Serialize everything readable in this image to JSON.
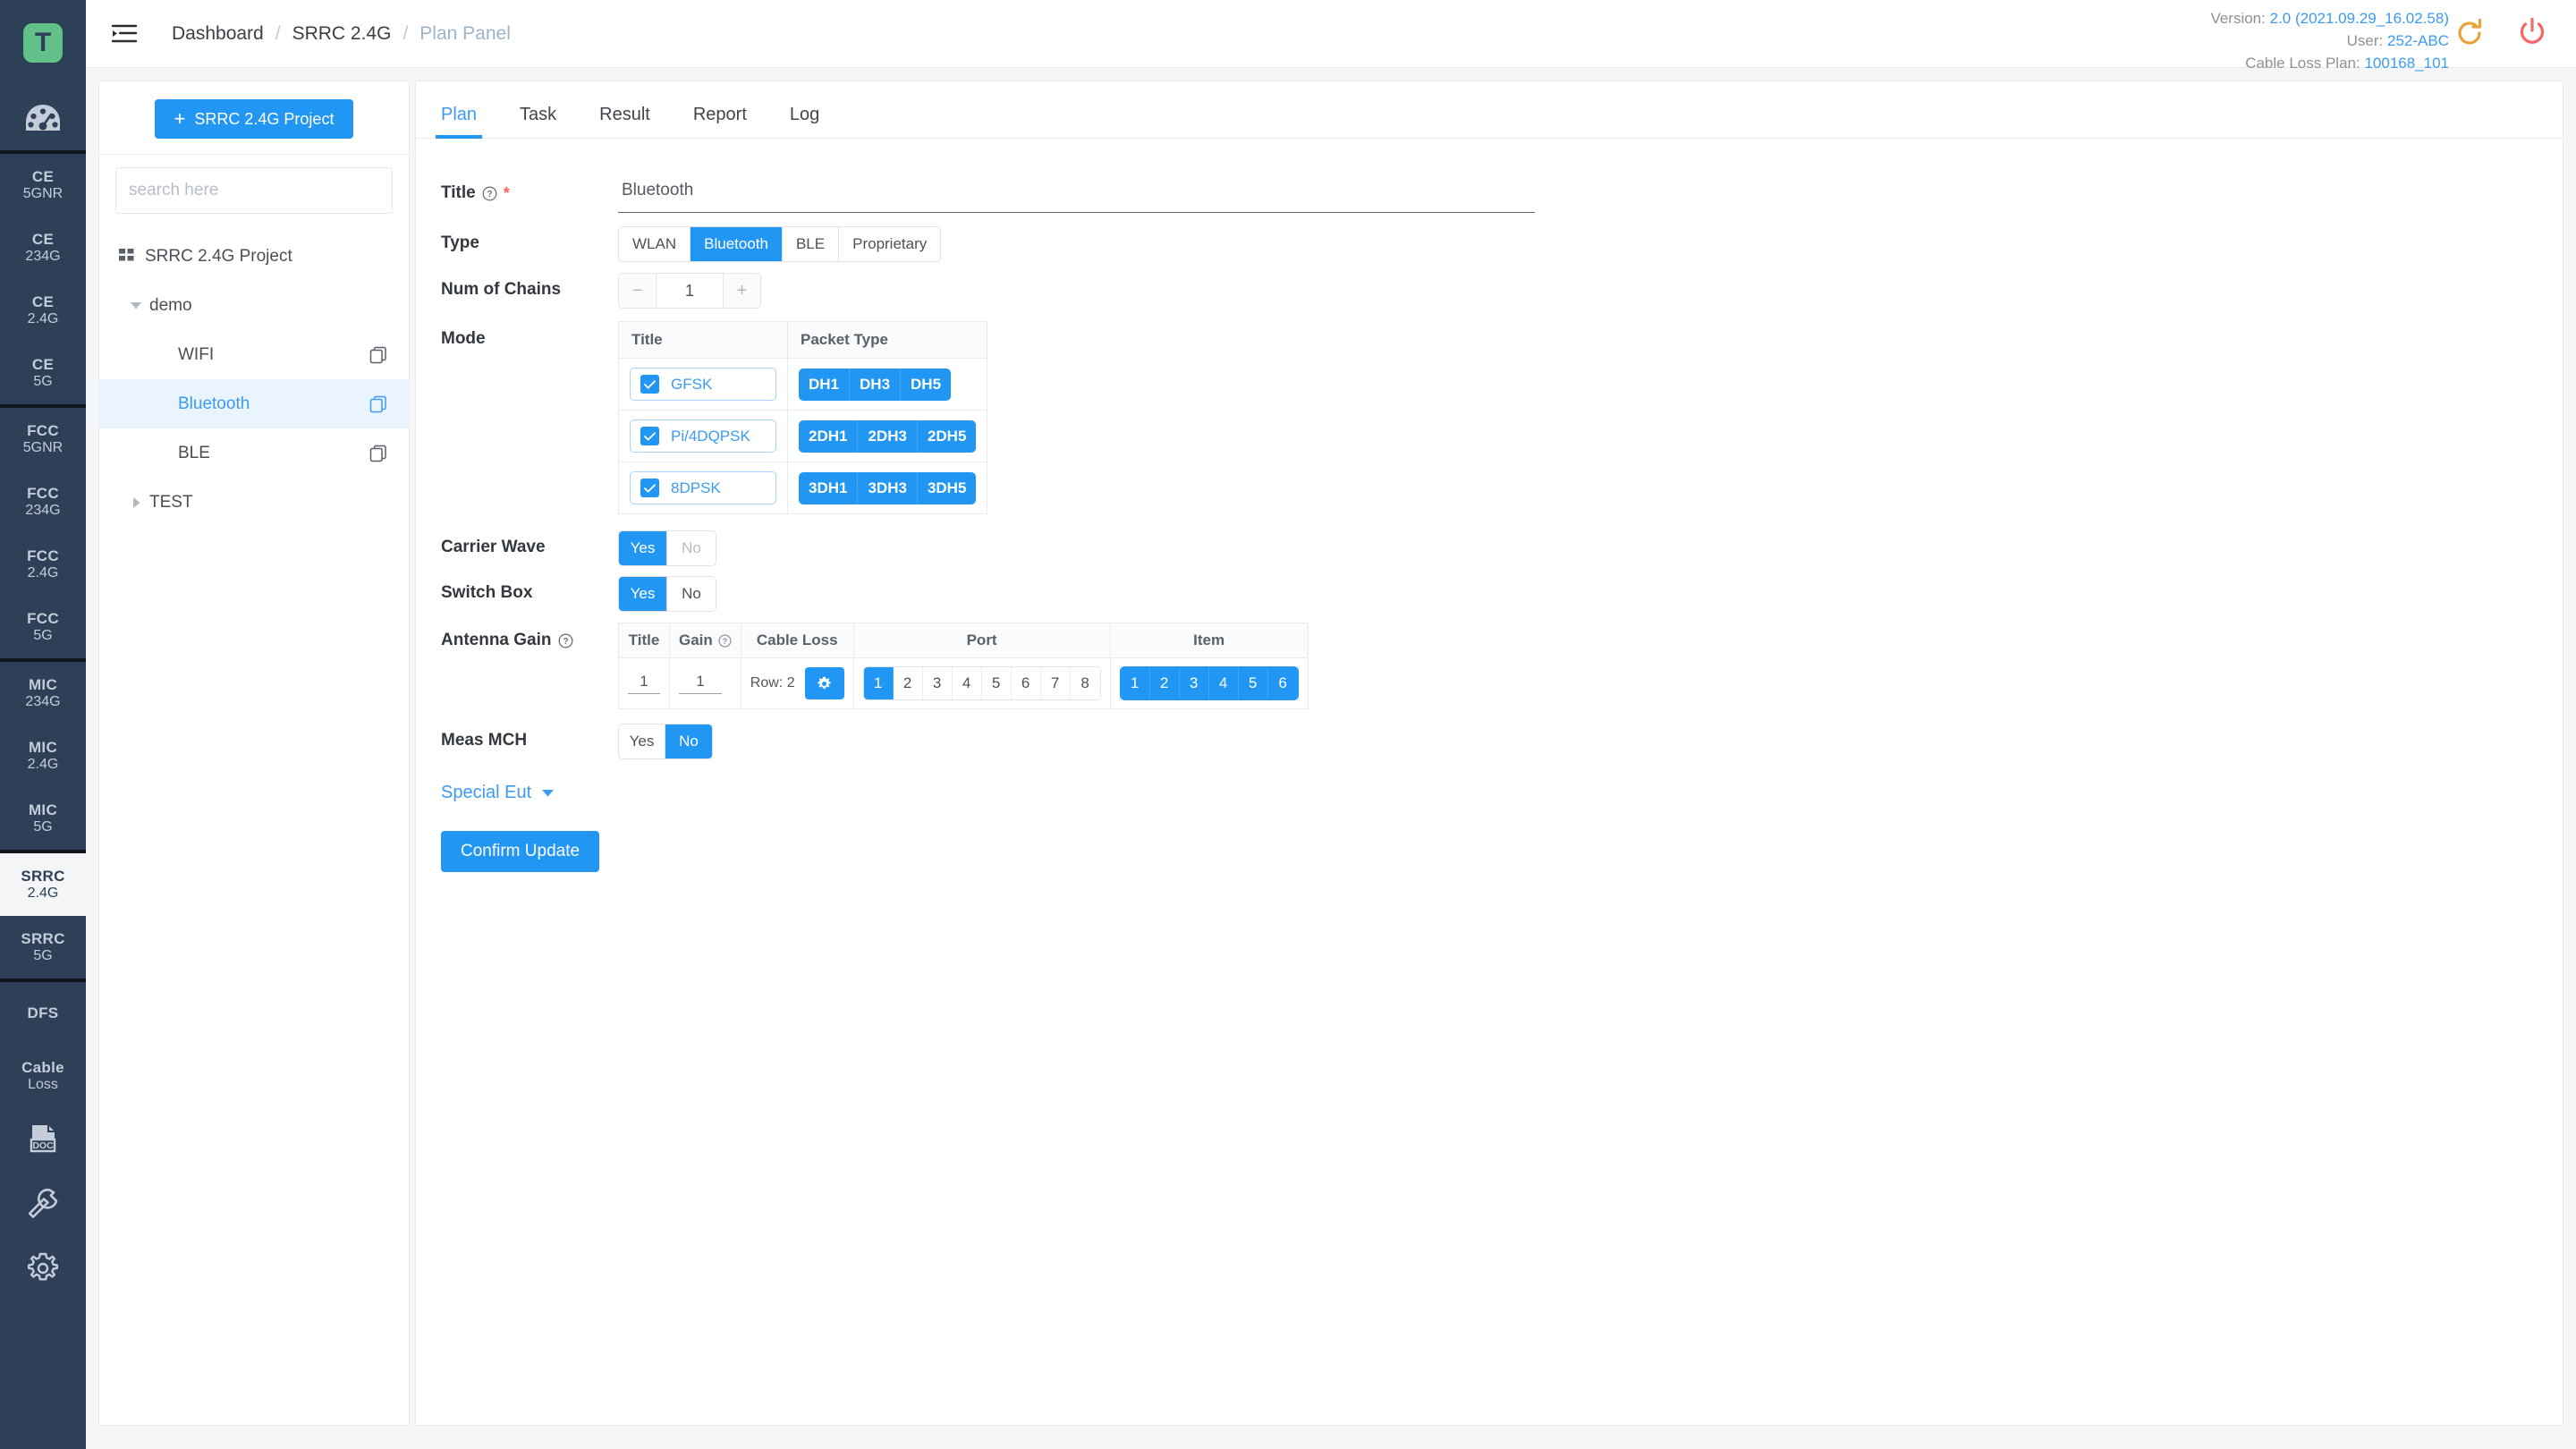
{
  "rail": {
    "logo_letter": "T",
    "items": [
      {
        "l1": "CE",
        "l2": "5GNR"
      },
      {
        "l1": "CE",
        "l2": "234G"
      },
      {
        "l1": "CE",
        "l2": "2.4G"
      },
      {
        "l1": "CE",
        "l2": "5G"
      },
      {
        "l1": "FCC",
        "l2": "5GNR"
      },
      {
        "l1": "FCC",
        "l2": "234G"
      },
      {
        "l1": "FCC",
        "l2": "2.4G"
      },
      {
        "l1": "FCC",
        "l2": "5G"
      },
      {
        "l1": "MIC",
        "l2": "234G"
      },
      {
        "l1": "MIC",
        "l2": "2.4G"
      },
      {
        "l1": "MIC",
        "l2": "5G"
      },
      {
        "l1": "SRRC",
        "l2": "2.4G"
      },
      {
        "l1": "SRRC",
        "l2": "5G"
      },
      {
        "l1": "DFS",
        "l2": ""
      },
      {
        "l1": "Cable",
        "l2": "Loss"
      }
    ],
    "active_index": 11,
    "doc_icon_label": "DOC"
  },
  "header": {
    "breadcrumb": [
      "Dashboard",
      "SRRC 2.4G",
      "Plan Panel"
    ],
    "separator": "/",
    "version_label": "Version:",
    "version_value": "2.0 (2021.09.29_16.02.58)",
    "user_label": "User:",
    "user_value": "252-ABC",
    "cable_loss_label": "Cable Loss Plan:",
    "cable_loss_value": "100168_101",
    "accent_link": "#3c9bf0",
    "refresh_color": "#e8a33d",
    "power_color": "#f4676b"
  },
  "tree_panel": {
    "new_project_button": "SRRC 2.4G Project",
    "plus": "+",
    "search_placeholder": "search here",
    "search_value": "",
    "root": "SRRC 2.4G Project",
    "groups": [
      {
        "label": "demo",
        "expanded": true,
        "children": [
          {
            "label": "WIFI",
            "selected": false
          },
          {
            "label": "Bluetooth",
            "selected": true
          },
          {
            "label": "BLE",
            "selected": false
          }
        ]
      },
      {
        "label": "TEST",
        "expanded": false,
        "children": []
      }
    ]
  },
  "tabs": {
    "items": [
      "Plan",
      "Task",
      "Result",
      "Report",
      "Log"
    ],
    "active": "Plan"
  },
  "form": {
    "title": {
      "label": "Title",
      "required_mark": "*",
      "value": "Bluetooth"
    },
    "type": {
      "label": "Type",
      "options": [
        "WLAN",
        "Bluetooth",
        "BLE",
        "Proprietary"
      ],
      "selected": "Bluetooth"
    },
    "num_of_chains": {
      "label": "Num of Chains",
      "minus": "−",
      "plus": "+",
      "value": "1"
    },
    "mode": {
      "label": "Mode",
      "columns": [
        "Title",
        "Packet Type"
      ],
      "rows": [
        {
          "title": "GFSK",
          "checked": true,
          "packets": [
            "DH1",
            "DH3",
            "DH5"
          ]
        },
        {
          "title": "Pi/4DQPSK",
          "checked": true,
          "packets": [
            "2DH1",
            "2DH3",
            "2DH5"
          ]
        },
        {
          "title": "8DPSK",
          "checked": true,
          "packets": [
            "3DH1",
            "3DH3",
            "3DH5"
          ]
        }
      ]
    },
    "carrier_wave": {
      "label": "Carrier Wave",
      "options": [
        "Yes",
        "No"
      ],
      "selected": "Yes",
      "no_dimmed": true
    },
    "switch_box": {
      "label": "Switch Box",
      "options": [
        "Yes",
        "No"
      ],
      "selected": "Yes",
      "no_dimmed": false
    },
    "antenna_gain": {
      "label": "Antenna Gain",
      "columns": [
        "Title",
        "Gain",
        "Cable Loss",
        "Port",
        "Item"
      ],
      "row": {
        "title": "1",
        "gain": "1",
        "cable_loss_text": "Row: 2",
        "ports": [
          "1",
          "2",
          "3",
          "4",
          "5",
          "6",
          "7",
          "8"
        ],
        "ports_selected": [
          "1"
        ],
        "items": [
          "1",
          "2",
          "3",
          "4",
          "5",
          "6"
        ],
        "items_selected": [
          "1",
          "2",
          "3",
          "4",
          "5",
          "6"
        ]
      }
    },
    "meas_mch": {
      "label": "Meas MCH",
      "options": [
        "Yes",
        "No"
      ],
      "selected": "No"
    },
    "special_eut": {
      "label": "Special Eut"
    },
    "confirm_button": "Confirm Update"
  }
}
